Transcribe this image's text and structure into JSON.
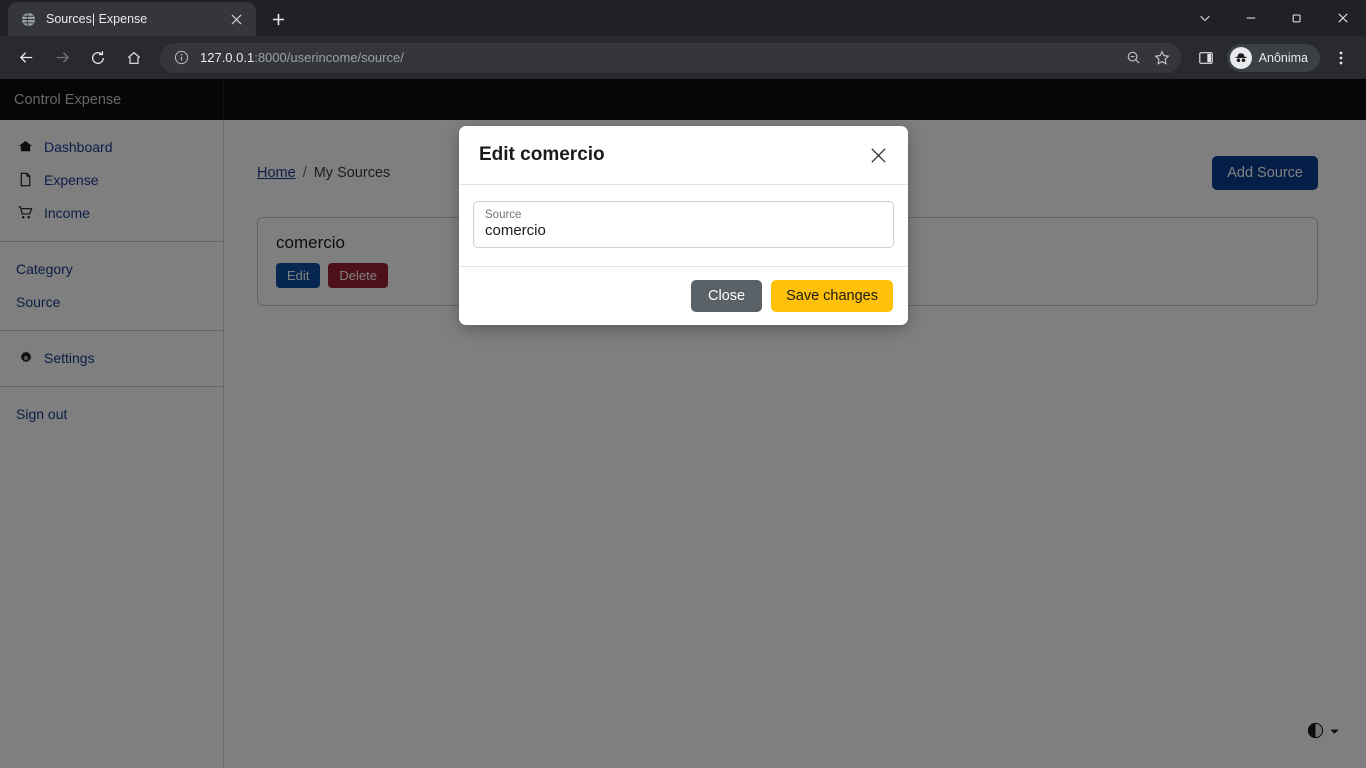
{
  "browser": {
    "tab": {
      "title": "Sources| Expense",
      "favicon": "globe-icon",
      "close": "×"
    },
    "newtab_label": "+",
    "window_controls": {
      "expand": "chevron-down-icon",
      "minimize": "minimize-icon",
      "maximize": "restore-icon",
      "close": "close-icon"
    },
    "nav": {
      "back": "back-arrow-icon",
      "forward": "forward-arrow-icon",
      "reload": "reload-icon",
      "home": "home-icon"
    },
    "omnibox": {
      "info_icon": "info-circle-icon",
      "host": "127.0.0.1",
      "path": ":8000/userincome/source/",
      "zoom_search_icon": "search-zoom-icon",
      "bookmark_icon": "star-icon"
    },
    "toolbar_right": {
      "side_panel_icon": "side-panel-icon",
      "incognito_label": "Anônima",
      "incognito_icon": "incognito-hat-icon",
      "menu_icon": "three-dots-vertical-icon"
    }
  },
  "app": {
    "brand": "Control Expense"
  },
  "sidebar": {
    "groups": [
      {
        "items": [
          {
            "label": "Dashboard",
            "icon": "home-icon"
          },
          {
            "label": "Expense",
            "icon": "document-icon"
          },
          {
            "label": "Income",
            "icon": "shopping-cart-icon"
          }
        ]
      },
      {
        "items": [
          {
            "label": "Category",
            "icon": ""
          },
          {
            "label": "Source",
            "icon": ""
          }
        ]
      },
      {
        "items": [
          {
            "label": "Settings",
            "icon": "gear-icon"
          }
        ]
      },
      {
        "items": [
          {
            "label": "Sign out",
            "icon": ""
          }
        ]
      }
    ]
  },
  "main": {
    "breadcrumb": {
      "home": "Home",
      "separator": "/",
      "current": "My Sources"
    },
    "add_button": "Add Source",
    "card": {
      "title": "comercio",
      "edit_label": "Edit",
      "delete_label": "Delete"
    },
    "dark_mode_toggle": {
      "icon": "half-circle-contrast-icon",
      "caret": "caret-down-icon"
    }
  },
  "modal": {
    "title": "Edit comercio",
    "close_icon": "close-x-icon",
    "field": {
      "label": "Source",
      "value": "comercio"
    },
    "close_button": "Close",
    "save_button": "Save changes"
  },
  "colors": {
    "accent_primary": "#0b3d91",
    "edit_blue": "#0b4ea2",
    "delete_red": "#9b2030",
    "save_amber": "#ffc107",
    "close_gray": "#5a6268",
    "link_blue": "#1a3a8f",
    "header_dark": "#0d0d0f"
  }
}
